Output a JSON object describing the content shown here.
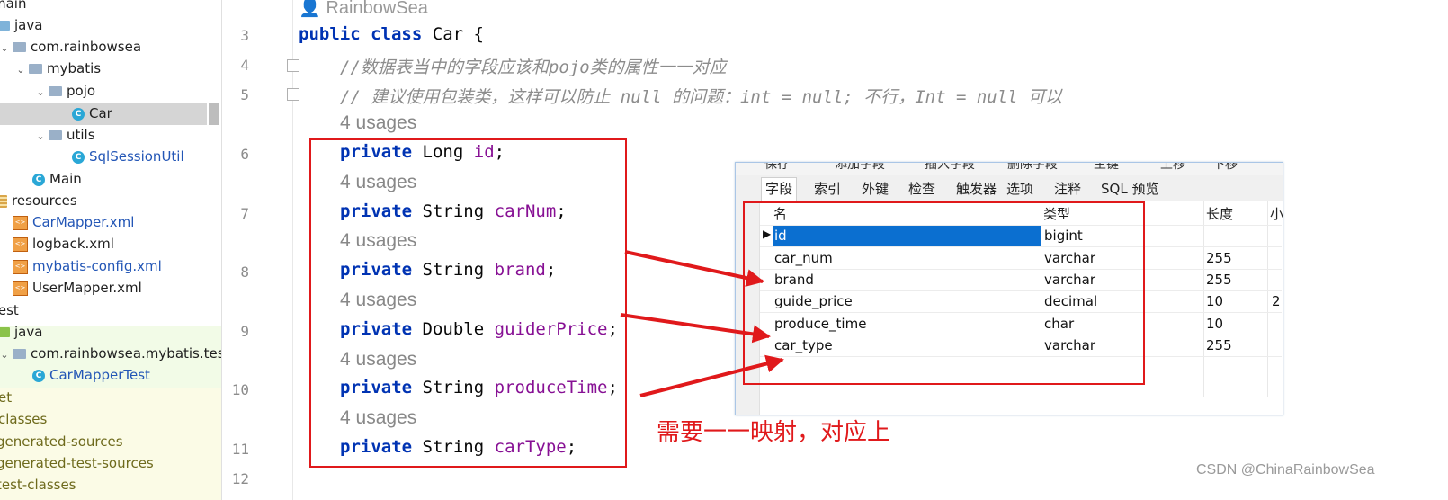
{
  "tree": {
    "rows": [
      {
        "label": "main"
      },
      {
        "label": "java"
      },
      {
        "label": "com.rainbowsea"
      },
      {
        "label": "mybatis"
      },
      {
        "label": "pojo"
      },
      {
        "label": "Car"
      },
      {
        "label": "utils"
      },
      {
        "label": "SqlSessionUtil"
      },
      {
        "label": "Main"
      },
      {
        "label": "resources"
      },
      {
        "label": "CarMapper.xml"
      },
      {
        "label": "logback.xml"
      },
      {
        "label": "mybatis-config.xml"
      },
      {
        "label": "UserMapper.xml"
      },
      {
        "label": "test"
      },
      {
        "label": "java"
      },
      {
        "label": "com.rainbowsea.mybatis.test"
      },
      {
        "label": "CarMapperTest"
      },
      {
        "label": "et"
      },
      {
        "label": "classes"
      },
      {
        "label": "generated-sources"
      },
      {
        "label": "generated-test-sources"
      },
      {
        "label": "test-classes"
      }
    ],
    "icon_c": "C",
    "icon_xml": "<>"
  },
  "editor": {
    "author_hint": "RainbowSea",
    "line_numbers": [
      "3",
      "4",
      "5",
      "6",
      "7",
      "8",
      "9",
      "10",
      "11",
      "12"
    ],
    "usages_label": "4 usages",
    "class_decl": {
      "kw1": "public",
      "kw2": "class",
      "name": "Car",
      "brace": "{"
    },
    "comment1": "//数据表当中的字段应该和pojo类的属性一一对应",
    "comment2": "// 建议使用包装类，这样可以防止 null 的问题：int = null; 不行，Int = null 可以",
    "fields": [
      {
        "mod": "private",
        "type": "Long",
        "name": "id",
        "end": ";"
      },
      {
        "mod": "private",
        "type": "String",
        "name": "carNum",
        "end": ";"
      },
      {
        "mod": "private",
        "type": "String",
        "name": "brand",
        "end": ";"
      },
      {
        "mod": "private",
        "type": "Double",
        "name": "guiderPrice",
        "end": ";"
      },
      {
        "mod": "private",
        "type": "String",
        "name": "produceTime",
        "end": ";"
      },
      {
        "mod": "private",
        "type": "String",
        "name": "carType",
        "end": ";"
      }
    ]
  },
  "db_dialog": {
    "toolbar": [
      "保存",
      "添加字段",
      "插入字段",
      "删除字段",
      "主键",
      "上移",
      "下移"
    ],
    "tabs": [
      "字段",
      "索引",
      "外键",
      "检查",
      "触发器",
      "选项",
      "注释",
      "SQL 预览"
    ],
    "active_tab": "字段",
    "headers": {
      "name": "名",
      "type": "类型",
      "length": "长度",
      "scale": "小"
    },
    "rows": [
      {
        "name": "id",
        "type": "bigint",
        "length": "",
        "scale": ""
      },
      {
        "name": "car_num",
        "type": "varchar",
        "length": "255",
        "scale": ""
      },
      {
        "name": "brand",
        "type": "varchar",
        "length": "255",
        "scale": ""
      },
      {
        "name": "guide_price",
        "type": "decimal",
        "length": "10",
        "scale": "2"
      },
      {
        "name": "produce_time",
        "type": "char",
        "length": "10",
        "scale": ""
      },
      {
        "name": "car_type",
        "type": "varchar",
        "length": "255",
        "scale": ""
      }
    ],
    "row_marker": "▶"
  },
  "annotation": {
    "text": "需要一一映射，对应上",
    "color": "#e0191b"
  },
  "watermark": "CSDN @ChinaRainbowSea"
}
